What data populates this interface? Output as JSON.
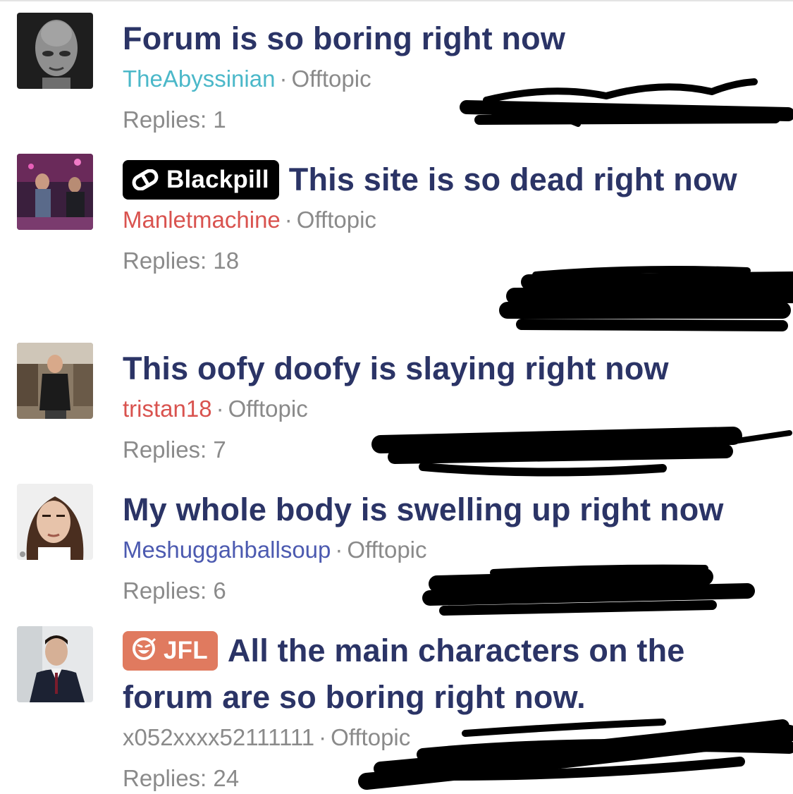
{
  "threads": [
    {
      "title": "Forum is so boring right now",
      "prefix": null,
      "author": "TheAbyssinian",
      "author_color": "#4bb8c9",
      "forum": "Offtopic",
      "replies": "Replies: 1",
      "avatar": "grey-alien-face"
    },
    {
      "title": "This site is so dead right now",
      "prefix": {
        "label": "Blackpill",
        "icon": "pill-icon",
        "color": "#000000"
      },
      "author": "Manletmachine",
      "author_color": "#d9534f",
      "forum": "Offtopic",
      "replies": "Replies: 18",
      "avatar": "stage-performer-photo"
    },
    {
      "title": "This oofy doofy is slaying right now",
      "prefix": null,
      "author": "tristan18",
      "author_color": "#d9534f",
      "forum": "Offtopic",
      "replies": "Replies: 7",
      "avatar": "man-in-warehouse-photo"
    },
    {
      "title": "My whole body is swelling up right now",
      "prefix": null,
      "author": "Meshuggahballsoup",
      "author_color": "#4c5ab0",
      "forum": "Offtopic",
      "replies": "Replies: 6",
      "avatar": "woman-selfie-photo"
    },
    {
      "title": "All the main characters on the forum are so boring right now.",
      "prefix": {
        "label": "JFL",
        "icon": "laughing-emoji-icon",
        "color": "#e07a5f"
      },
      "author": "x052xxxx52111111",
      "author_color": "#8a8a8a",
      "forum": "Offtopic",
      "replies": "Replies: 24",
      "avatar": "man-in-suit-photo"
    }
  ]
}
